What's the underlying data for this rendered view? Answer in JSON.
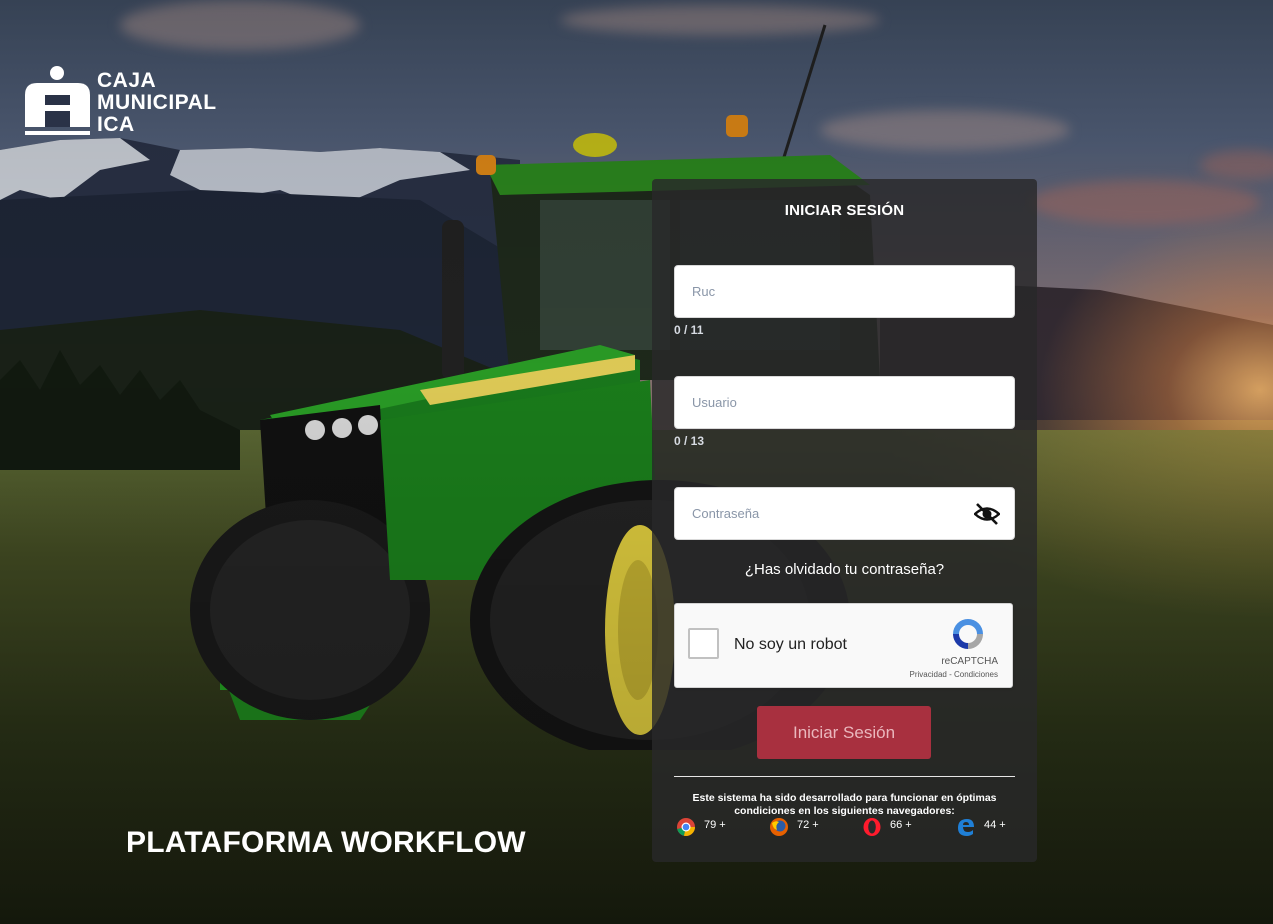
{
  "logo": {
    "line1": "CAJA",
    "line2": "MUNICIPAL",
    "line3": "ICA"
  },
  "platform_title": "PLATAFORMA WORKFLOW",
  "login": {
    "title": "INICIAR SESIÓN",
    "ruc": {
      "placeholder": "Ruc",
      "value": "",
      "counter": "0 / 11"
    },
    "usuario": {
      "placeholder": "Usuario",
      "value": "",
      "counter": "0 / 13"
    },
    "password": {
      "placeholder": "Contraseña",
      "value": ""
    },
    "forgot_link": "¿Has olvidado tu contraseña?",
    "submit_label": "Iniciar Sesión"
  },
  "captcha": {
    "label": "No soy un robot",
    "brand": "reCAPTCHA",
    "links": "Privacidad - Condiciones"
  },
  "browser_notice": "Este sistema ha sido desarrollado para funcionar en óptimas condiciones en los siguientes navegadores:",
  "browsers": [
    {
      "icon": "chrome-icon",
      "version": "79 +"
    },
    {
      "icon": "firefox-icon",
      "version": "72 +"
    },
    {
      "icon": "opera-icon",
      "version": "66 +"
    },
    {
      "icon": "edge-icon",
      "version": "44 +"
    }
  ],
  "colors": {
    "submit_button": "#a8303f",
    "panel_background": "#28282a"
  }
}
